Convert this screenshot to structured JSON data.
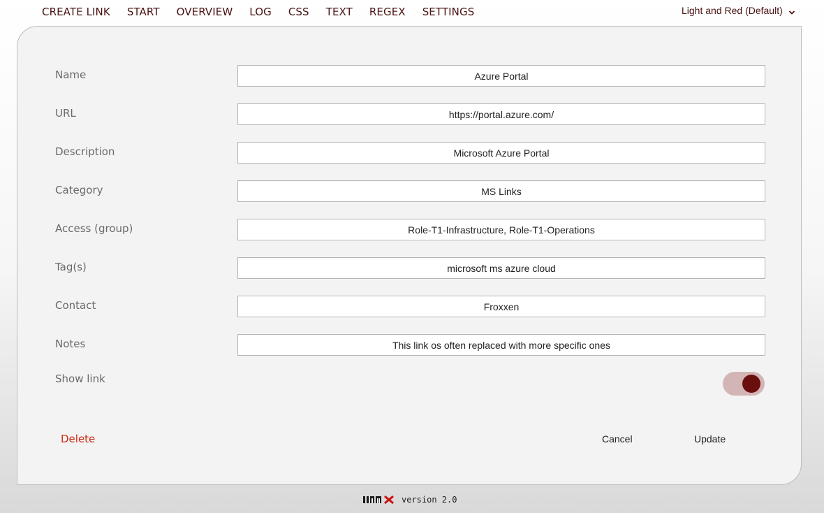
{
  "nav": {
    "items": [
      {
        "label": "CREATE LINK"
      },
      {
        "label": "START"
      },
      {
        "label": "OVERVIEW"
      },
      {
        "label": "LOG"
      },
      {
        "label": "CSS"
      },
      {
        "label": "TEXT"
      },
      {
        "label": "REGEX"
      },
      {
        "label": "SETTINGS"
      }
    ]
  },
  "theme": {
    "selected": "Light and Red (Default)"
  },
  "form": {
    "fields": [
      {
        "label": "Name",
        "value": "Azure Portal"
      },
      {
        "label": "URL",
        "value": "https://portal.azure.com/"
      },
      {
        "label": "Description",
        "value": "Microsoft Azure Portal"
      },
      {
        "label": "Category",
        "value": "MS Links"
      },
      {
        "label": "Access (group)",
        "value": "Role-T1-Infrastructure, Role-T1-Operations"
      },
      {
        "label": "Tag(s)",
        "value": "microsoft ms azure cloud"
      },
      {
        "label": "Contact",
        "value": "Froxxen"
      },
      {
        "label": "Notes",
        "value": "This link os often replaced with more specific ones"
      }
    ],
    "show_link": {
      "label": "Show link",
      "enabled": true
    }
  },
  "actions": {
    "delete": "Delete",
    "cancel": "Cancel",
    "update": "Update"
  },
  "footer": {
    "version": "version 2.0"
  },
  "colors": {
    "accent": "#6a0e0e",
    "delete": "#cc2a14",
    "toggle_track": "#d4b5b5"
  }
}
